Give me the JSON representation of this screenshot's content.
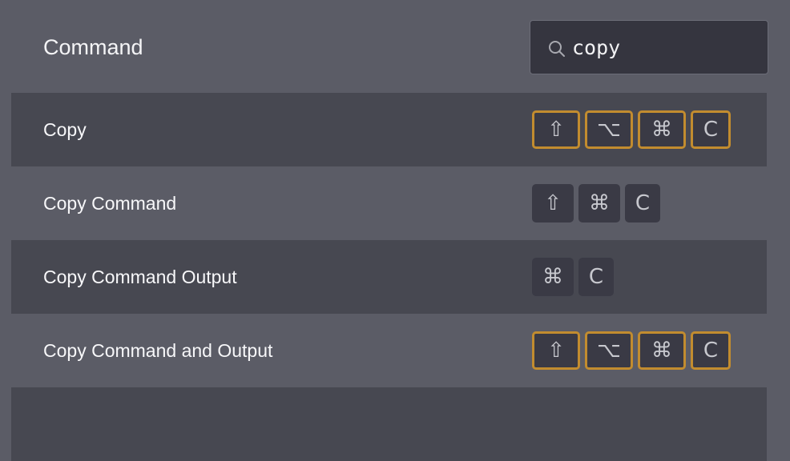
{
  "header": {
    "title": "Command",
    "search_value": "copy",
    "search_icon": "search-icon"
  },
  "rows": [
    {
      "label": "Copy",
      "keys": [
        "⇧",
        "⌥",
        "⌘",
        "C"
      ],
      "highlighted": true
    },
    {
      "label": "Copy Command",
      "keys": [
        "⇧",
        "⌘",
        "C"
      ],
      "highlighted": false
    },
    {
      "label": "Copy Command Output",
      "keys": [
        "⌘",
        "C"
      ],
      "highlighted": false
    },
    {
      "label": "Copy Command and Output",
      "keys": [
        "⇧",
        "⌥",
        "⌘",
        "C"
      ],
      "highlighted": true
    }
  ],
  "colors": {
    "background": "#5b5c66",
    "row_alt": "#474851",
    "key_bg": "#3a3a45",
    "key_highlight_border": "#c28c2f"
  }
}
